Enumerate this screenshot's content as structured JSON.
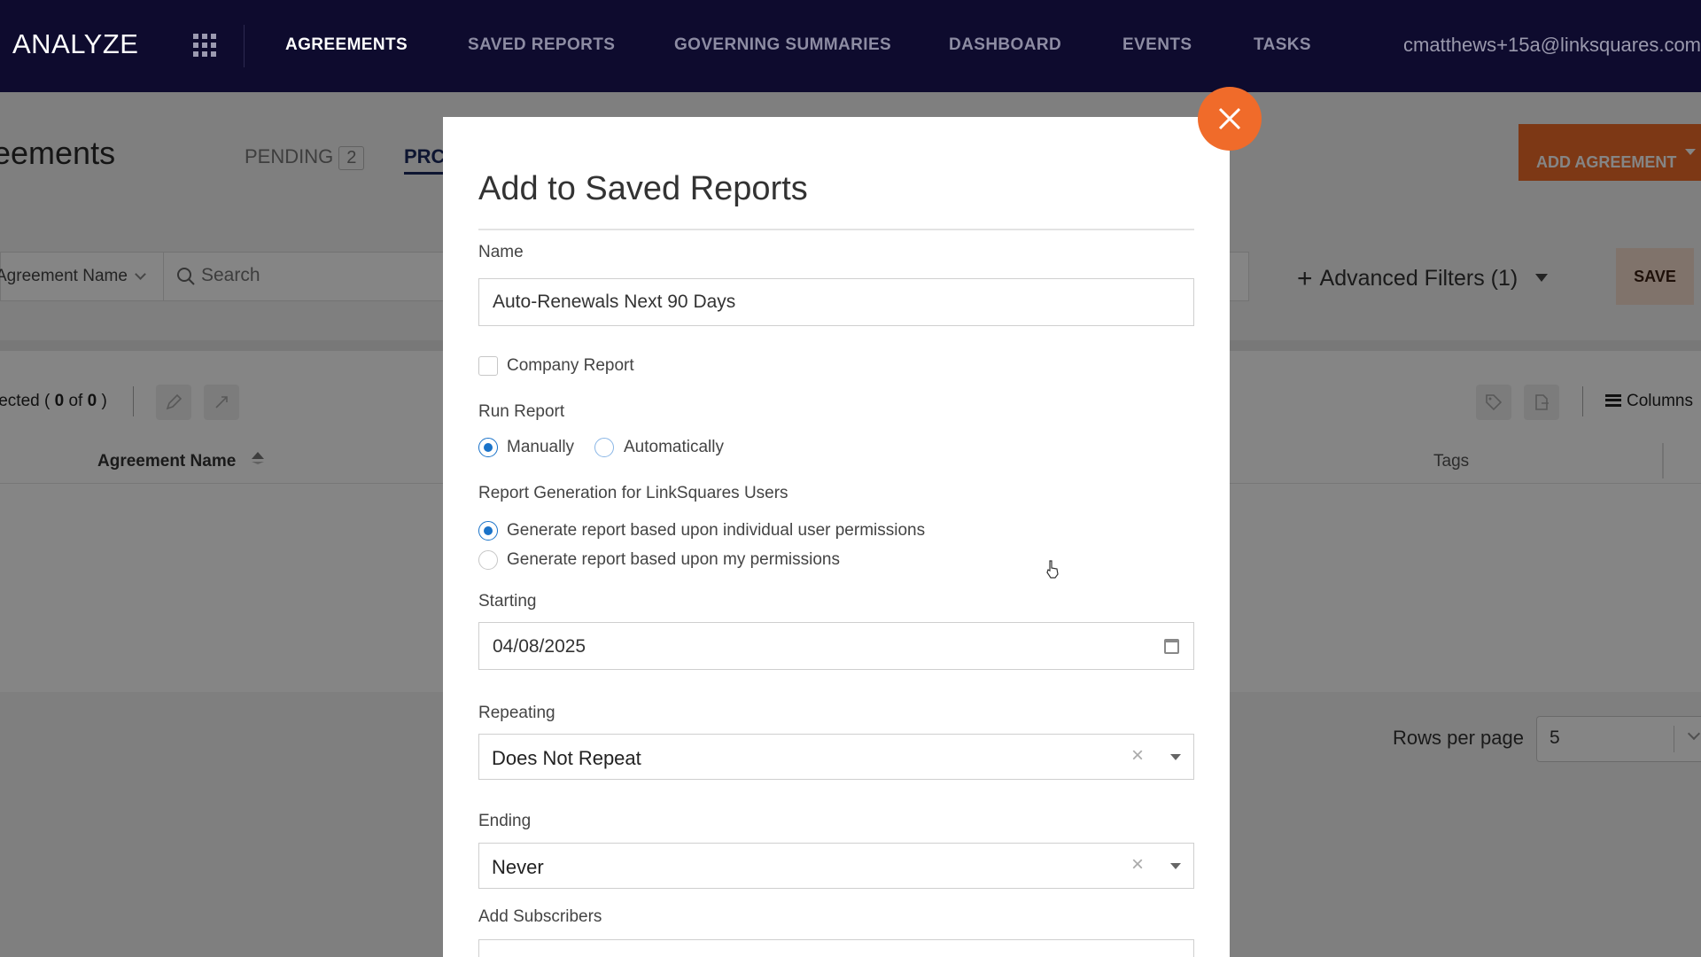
{
  "nav": {
    "brand": "ANALYZE",
    "items": [
      "AGREEMENTS",
      "SAVED REPORTS",
      "GOVERNING SUMMARIES",
      "DASHBOARD",
      "EVENTS",
      "TASKS"
    ],
    "active_index": 0,
    "user_email": "cmatthews+15a@linksquares.com"
  },
  "page": {
    "title": "eements",
    "tab_pending": "PENDING",
    "tab_pending_count": "2",
    "tab_pro": "PRC",
    "add_agreement": "ADD AGREEMENT",
    "filter_field": "Agreement Name",
    "search_placeholder": "Search",
    "advanced_filters": "Advanced Filters (1)",
    "save": "SAVE",
    "selected_prefix": "lected (",
    "selected_count": "0",
    "selected_of": "of",
    "selected_total": "0",
    "selected_suffix": ")",
    "columns": "Columns",
    "col_agreement_name": "Agreement Name",
    "col_tags": "Tags",
    "rows_per_page_label": "Rows per page",
    "rows_per_page_value": "5"
  },
  "modal": {
    "title": "Add to Saved Reports",
    "name_label": "Name",
    "name_value": "Auto-Renewals Next 90 Days",
    "company_report_label": "Company Report",
    "company_report_checked": false,
    "run_report_label": "Run Report",
    "run_manually": "Manually",
    "run_automatically": "Automatically",
    "run_selected": "Manually",
    "report_gen_label": "Report Generation for LinkSquares Users",
    "gen_individual": "Generate report based upon individual user permissions",
    "gen_mine": "Generate report based upon my permissions",
    "gen_selected": "individual",
    "starting_label": "Starting",
    "starting_value": "04/08/2025",
    "repeating_label": "Repeating",
    "repeating_value": "Does Not Repeat",
    "ending_label": "Ending",
    "ending_value": "Never",
    "subscribers_label": "Add Subscribers"
  },
  "colors": {
    "nav_bg": "#0e0b2e",
    "accent_orange": "#f06b2a",
    "radio_blue": "#1a73c9",
    "save_bg": "#f6dccd"
  },
  "icons": [
    "apps-grid-icon",
    "search-icon",
    "chevron-down-icon",
    "plus-icon",
    "edit-icon",
    "link-icon",
    "tag-icon",
    "export-icon",
    "columns-icon",
    "sort-icon",
    "calendar-icon",
    "clear-icon",
    "close-icon",
    "pointer-cursor-icon"
  ]
}
